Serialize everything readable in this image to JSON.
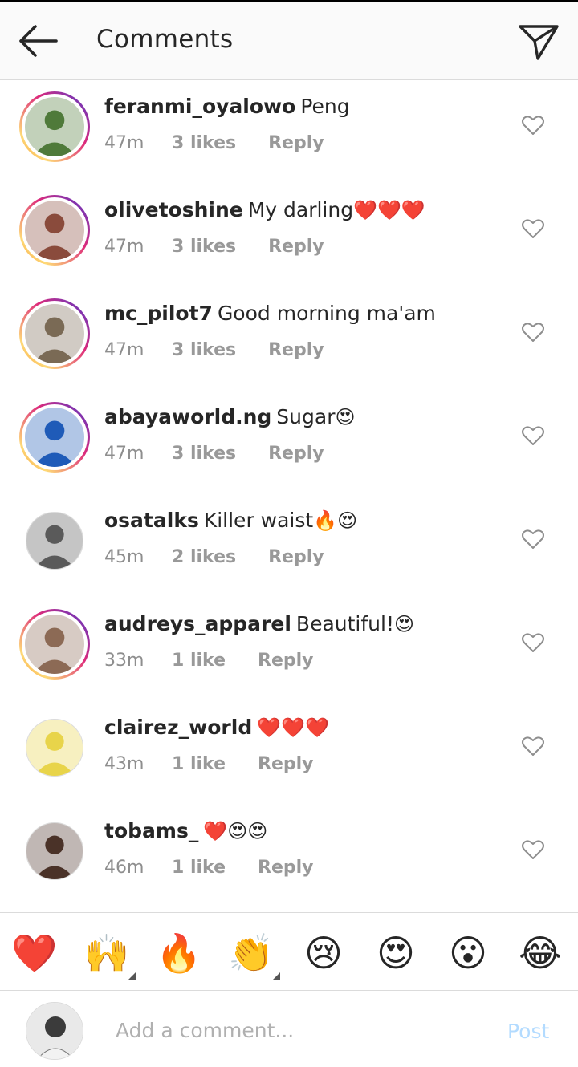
{
  "header": {
    "title": "Comments",
    "back_icon": "arrow-left-icon",
    "send_icon": "paper-plane-icon"
  },
  "comments": [
    {
      "username": "feranmi_oyalowo",
      "text": "Peng",
      "emoji": "",
      "time": "47m",
      "likes": "3 likes",
      "reply": "Reply",
      "story_ring": true,
      "avatar_color": "#4f7a3a"
    },
    {
      "username": "olivetoshine",
      "text": "My darling",
      "emoji": "❤️❤️❤️",
      "time": "47m",
      "likes": "3 likes",
      "reply": "Reply",
      "story_ring": true,
      "avatar_color": "#8a4b3c"
    },
    {
      "username": "mc_pilot7",
      "text": "Good morning ma'am",
      "emoji": "",
      "time": "47m",
      "likes": "3 likes",
      "reply": "Reply",
      "story_ring": true,
      "avatar_color": "#7a6a55"
    },
    {
      "username": "abayaworld.ng",
      "text": "Sugar",
      "emoji": "😍",
      "time": "47m",
      "likes": "3 likes",
      "reply": "Reply",
      "story_ring": true,
      "avatar_color": "#1f5bb8"
    },
    {
      "username": "osatalks",
      "text": "Killer waist",
      "emoji": "🔥😍",
      "time": "45m",
      "likes": "2 likes",
      "reply": "Reply",
      "story_ring": false,
      "avatar_color": "#5a5a5a"
    },
    {
      "username": "audreys_apparel",
      "text": "Beautiful!",
      "emoji": "😍",
      "time": "33m",
      "likes": "1 like",
      "reply": "Reply",
      "story_ring": true,
      "avatar_color": "#8c6a55"
    },
    {
      "username": "clairez_world",
      "text": "",
      "emoji": "❤️❤️❤️",
      "time": "43m",
      "likes": "1 like",
      "reply": "Reply",
      "story_ring": false,
      "avatar_color": "#e8d44a"
    },
    {
      "username": "tobams_",
      "text": "",
      "emoji": "❤️😍😍",
      "time": "46m",
      "likes": "1 like",
      "reply": "Reply",
      "story_ring": false,
      "avatar_color": "#4a3228"
    }
  ],
  "emoji_bar": [
    "❤️",
    "🙌",
    "🔥",
    "👏",
    "😢",
    "😍",
    "😮",
    "😂"
  ],
  "composer": {
    "placeholder": "Add a comment...",
    "post_label": "Post"
  },
  "colors": {
    "text": "#262626",
    "muted": "#8e8e8e",
    "post_disabled": "#b3dbff",
    "divider": "#dbdbdb"
  }
}
